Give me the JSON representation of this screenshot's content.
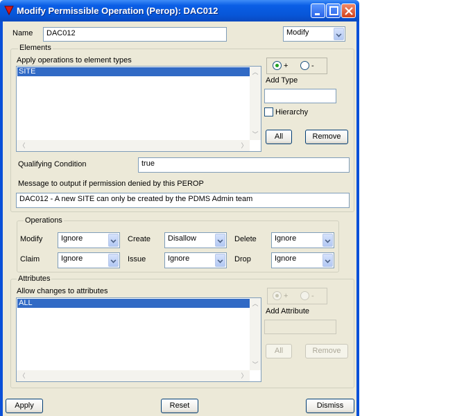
{
  "window": {
    "title": "Modify Permissible Operation (Perop): DAC012"
  },
  "name_row": {
    "label": "Name",
    "value": "DAC012",
    "mode_selected": "Modify"
  },
  "elements": {
    "group_label": "Elements",
    "list_caption": "Apply operations to element types",
    "items": [
      "SITE"
    ],
    "radio_plus": "+",
    "radio_minus": "-",
    "add_type_label": "Add Type",
    "add_type_value": "",
    "hierarchy_label": "Hierarchy",
    "all_button": "All",
    "remove_button": "Remove",
    "qualifying_label": "Qualifying Condition",
    "qualifying_value": "true",
    "message_label": "Message to output if permission denied by this PEROP",
    "message_value": "DAC012 - A new SITE can only be created by the PDMS Admin team"
  },
  "operations": {
    "group_label": "Operations",
    "modify_label": "Modify",
    "modify_value": "Ignore",
    "create_label": "Create",
    "create_value": "Disallow",
    "delete_label": "Delete",
    "delete_value": "Ignore",
    "claim_label": "Claim",
    "claim_value": "Ignore",
    "issue_label": "Issue",
    "issue_value": "Ignore",
    "drop_label": "Drop",
    "drop_value": "Ignore"
  },
  "attributes": {
    "group_label": "Attributes",
    "list_caption": "Allow changes to attributes",
    "items": [
      "ALL"
    ],
    "radio_plus": "+",
    "radio_minus": "-",
    "add_attribute_label": "Add Attribute",
    "add_attribute_value": "",
    "all_button": "All",
    "remove_button": "Remove"
  },
  "footer": {
    "apply": "Apply",
    "reset": "Reset",
    "dismiss": "Dismiss"
  }
}
